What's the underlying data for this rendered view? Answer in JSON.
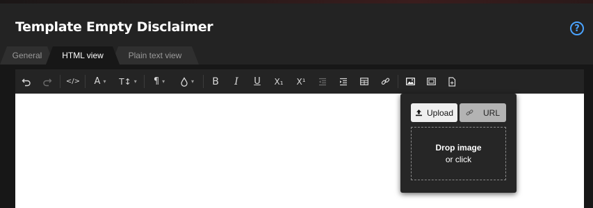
{
  "header": {
    "title": "Template Empty Disclaimer",
    "help_icon": "question-circle-icon"
  },
  "tabs": [
    {
      "label": "General",
      "active": false
    },
    {
      "label": "HTML view",
      "active": true
    },
    {
      "label": "Plain text view",
      "active": false
    }
  ],
  "toolbar": {
    "font_color_glyph": "A",
    "font_size_glyph": "T↕",
    "paragraph_glyph": "¶",
    "bold": "B",
    "italic": "I",
    "underline": "U",
    "subscript": "X₁",
    "superscript": "X¹",
    "icons": [
      "undo-icon",
      "redo-icon",
      "code-view-icon",
      "font-color-icon",
      "font-size-icon",
      "paragraph-format-icon",
      "background-color-icon",
      "bold-icon",
      "italic-icon",
      "underline-icon",
      "subscript-icon",
      "superscript-icon",
      "outdent-icon",
      "indent-icon",
      "table-icon",
      "link-icon",
      "insert-image-icon",
      "insert-video-icon",
      "insert-file-icon"
    ]
  },
  "image_popup": {
    "upload_label": "Upload",
    "url_label": "URL",
    "drop_line1": "Drop image",
    "drop_line2": "or click"
  },
  "colors": {
    "accent": "#4aa3ff",
    "background": "#1e1e1e",
    "toolbar": "#242424",
    "editor": "#ffffff"
  }
}
